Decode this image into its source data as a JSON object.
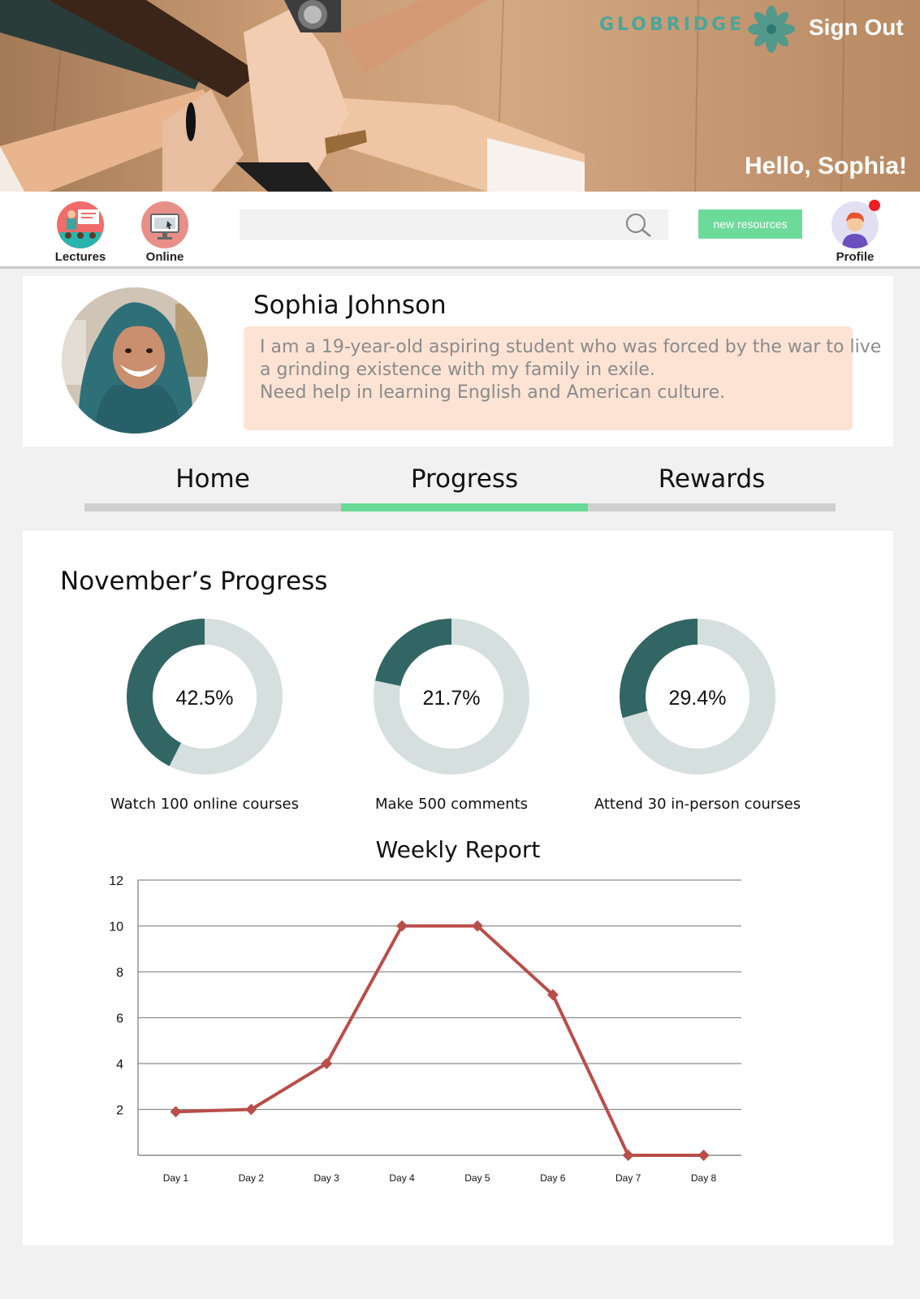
{
  "header": {
    "brand": "GLOBRIDGE",
    "sign_out": "Sign Out",
    "greeting": "Hello, Sophia!"
  },
  "nav": {
    "lectures": "Lectures",
    "online": "Online",
    "search_placeholder": "",
    "new_resources": "new resources",
    "profile": "Profile"
  },
  "profile": {
    "name": "Sophia Johnson",
    "bio": [
      "I am a 19-year-old aspiring student who was forced by the war to live",
      "a grinding existence with my family in exile.",
      "Need help in learning English and American culture."
    ]
  },
  "tabs": [
    "Home",
    "Progress",
    "Rewards"
  ],
  "active_tab": "Progress",
  "progress": {
    "title": "November’s Progress",
    "goals": [
      {
        "percent_label": "42.5%",
        "value": 42.5,
        "label": "Watch 100 online courses"
      },
      {
        "percent_label": "21.7%",
        "value": 21.7,
        "label": "Make 500 comments"
      },
      {
        "percent_label": "29.4%",
        "value": 29.4,
        "label": "Attend 30 in-person courses"
      }
    ],
    "colors": {
      "fill": "#326664",
      "track": "#d5dfde"
    }
  },
  "chart_data": {
    "type": "line",
    "title": "Weekly Report",
    "categories": [
      "Day 1",
      "Day 2",
      "Day 3",
      "Day 4",
      "Day 5",
      "Day 6",
      "Day 7",
      "Day 8"
    ],
    "values": [
      1.9,
      2,
      4,
      10,
      10,
      7,
      0,
      0
    ],
    "ylim": [
      0,
      12
    ],
    "yticks": [
      2,
      4,
      6,
      8,
      10,
      12
    ],
    "grid": true,
    "xlabel": "",
    "ylabel": "",
    "line_color": "#b94e4a"
  }
}
